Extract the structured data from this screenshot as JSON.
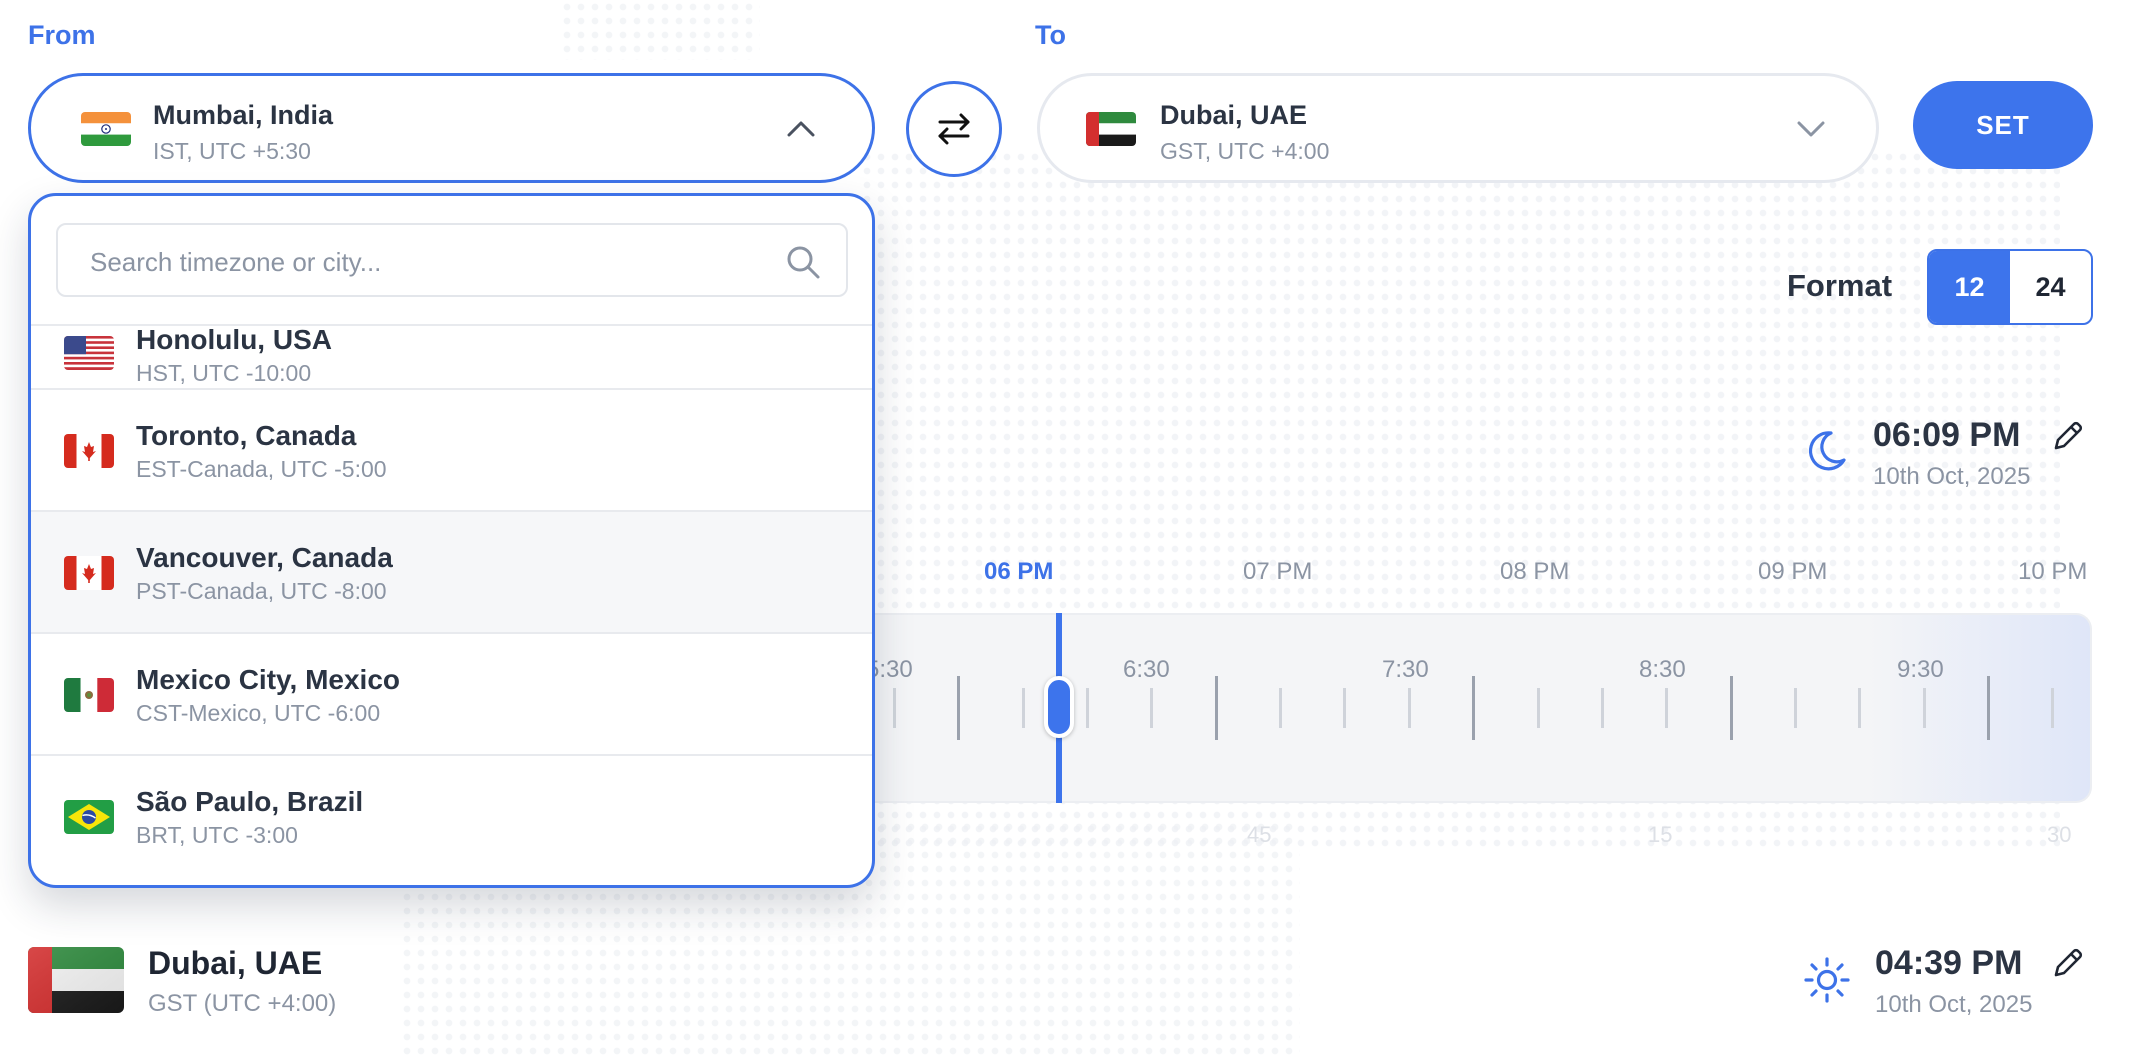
{
  "from": {
    "label": "From",
    "city": "Mumbai, India",
    "tz": "IST, UTC +5:30",
    "flag": "india-flag"
  },
  "to": {
    "label": "To",
    "city": "Dubai, UAE",
    "tz": "GST, UTC +4:00",
    "flag": "uae-flag"
  },
  "set_label": "SET",
  "format": {
    "label": "Format",
    "options": [
      "12",
      "24"
    ],
    "selected": "12"
  },
  "source_time": {
    "time": "06:09 PM",
    "date": "10th Oct, 2025",
    "icon": "moon-icon"
  },
  "timeline": {
    "hour_labels": [
      "06 PM",
      "07 PM",
      "08 PM",
      "09 PM",
      "10 PM"
    ],
    "active_hour": "06 PM",
    "half_labels": [
      "5:30",
      "6:30",
      "7:30",
      "8:30",
      "9:30"
    ],
    "minute_labels": [
      "45",
      "15",
      "30"
    ]
  },
  "dropdown": {
    "search_placeholder": "Search timezone or city...",
    "items": [
      {
        "city": "Honolulu, USA",
        "tz": "HST, UTC -10:00",
        "flag": "usa-flag"
      },
      {
        "city": "Toronto, Canada",
        "tz": "EST-Canada, UTC -5:00",
        "flag": "canada-flag"
      },
      {
        "city": "Vancouver, Canada",
        "tz": "PST-Canada, UTC -8:00",
        "flag": "canada-flag"
      },
      {
        "city": "Mexico City, Mexico",
        "tz": "CST-Mexico, UTC -6:00",
        "flag": "mexico-flag"
      },
      {
        "city": "São Paulo, Brazil",
        "tz": "BRT, UTC -3:00",
        "flag": "brazil-flag"
      }
    ]
  },
  "target": {
    "city": "Dubai, UAE",
    "tz": "GST (UTC +4:00)",
    "time": "04:39 PM",
    "date": "10th Oct, 2025",
    "icon": "sun-icon"
  },
  "colors": {
    "accent": "#3d72e8",
    "muted": "#8b94a3",
    "text": "#2b3443"
  }
}
